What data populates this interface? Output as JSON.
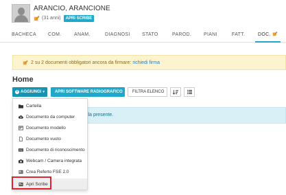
{
  "patient": {
    "name": "ARANCIO, ARANCIONE",
    "age": "(31 anni)",
    "badge": "APRI SCRIBE"
  },
  "tabs": [
    {
      "label": "BACHECA"
    },
    {
      "label": "COM."
    },
    {
      "label": "ANAM."
    },
    {
      "label": "DIAGNOSI"
    },
    {
      "label": "STATO"
    },
    {
      "label": "PAROD."
    },
    {
      "label": "PIANI"
    },
    {
      "label": "FATT."
    },
    {
      "label": "DOC."
    }
  ],
  "warning": {
    "text": "2 su 2 documenti obbligatori ancora da firmare:",
    "link": "richiedi firma"
  },
  "section_title": "Home",
  "toolbar": {
    "add_label": "AGGIUNGI",
    "radio_label": "APRI SOFTWARE RADIOGRAFICO",
    "filter_label": "FILTRA ELENCO"
  },
  "info": {
    "text": "lla presente."
  },
  "dropdown": {
    "items": [
      {
        "label": "Cartella",
        "icon": "folder-icon"
      },
      {
        "label": "Documento da computer",
        "icon": "cloud-upload-icon"
      },
      {
        "label": "Documento modello",
        "icon": "template-icon"
      },
      {
        "label": "Documento vuoto",
        "icon": "blank-file-icon"
      },
      {
        "label": "Documento di riconoscimento",
        "icon": "id-card-icon"
      },
      {
        "label": "Webcam / Camera integrata",
        "icon": "camera-icon"
      },
      {
        "label": "Crea Referto FSE 2.0",
        "icon": "report-icon"
      },
      {
        "label": "Apri Scribe",
        "icon": "scribe-icon"
      }
    ]
  },
  "colors": {
    "accent": "#1fa8c9",
    "warning_bg": "#fcf3cf",
    "info_bg": "#d9f0f7",
    "highlight_border": "#e0202c",
    "pencil": "#f0a030"
  }
}
